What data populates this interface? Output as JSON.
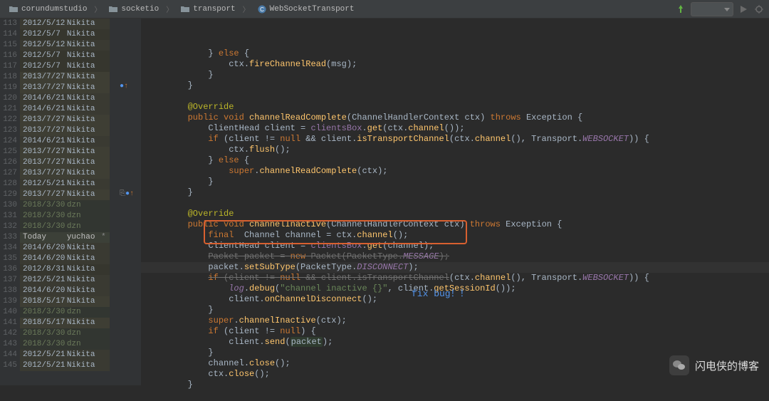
{
  "breadcrumbs": [
    {
      "icon": "folder",
      "label": "corundumstudio"
    },
    {
      "icon": "folder",
      "label": "socketio"
    },
    {
      "icon": "folder",
      "label": "transport"
    },
    {
      "icon": "class",
      "label": "WebSocketTransport"
    }
  ],
  "annotations": [
    {
      "line": 113,
      "date": "2012/5/12",
      "author": "Nikita",
      "cls": "bg-a"
    },
    {
      "line": 114,
      "date": "2012/5/7",
      "author": "Nikita",
      "cls": "bg-b"
    },
    {
      "line": 115,
      "date": "2012/5/12",
      "author": "Nikita",
      "cls": "bg-a"
    },
    {
      "line": 116,
      "date": "2012/5/7",
      "author": "Nikita",
      "cls": "bg-b"
    },
    {
      "line": 117,
      "date": "2012/5/7",
      "author": "Nikita",
      "cls": "bg-b"
    },
    {
      "line": 118,
      "date": "2013/7/27",
      "author": "Nikita",
      "cls": "bg-c"
    },
    {
      "line": 119,
      "date": "2013/7/27",
      "author": "Nikita",
      "cls": "bg-c",
      "marker": "o↑"
    },
    {
      "line": 120,
      "date": "2014/6/21",
      "author": "Nikita",
      "cls": "bg-a"
    },
    {
      "line": 121,
      "date": "2014/6/21",
      "author": "Nikita",
      "cls": "bg-a"
    },
    {
      "line": 122,
      "date": "2013/7/27",
      "author": "Nikita",
      "cls": "bg-c"
    },
    {
      "line": 123,
      "date": "2013/7/27",
      "author": "Nikita",
      "cls": "bg-c"
    },
    {
      "line": 124,
      "date": "2014/6/21",
      "author": "Nikita",
      "cls": "bg-a"
    },
    {
      "line": 125,
      "date": "2013/7/27",
      "author": "Nikita",
      "cls": "bg-c"
    },
    {
      "line": 126,
      "date": "2013/7/27",
      "author": "Nikita",
      "cls": "bg-c"
    },
    {
      "line": 127,
      "date": "2013/7/27",
      "author": "Nikita",
      "cls": "bg-c"
    },
    {
      "line": 128,
      "date": "2012/5/21",
      "author": "Nikita",
      "cls": "bg-a"
    },
    {
      "line": 129,
      "date": "2013/7/27",
      "author": "Nikita",
      "cls": "bg-c",
      "marker": "⎘o↑"
    },
    {
      "line": 130,
      "date": "2018/3/30",
      "author": "dzn",
      "cls": "bg-d ann-dzn"
    },
    {
      "line": 131,
      "date": "2018/3/30",
      "author": "dzn",
      "cls": "bg-d ann-dzn"
    },
    {
      "line": 132,
      "date": "2018/3/30",
      "author": "dzn",
      "cls": "bg-d ann-dzn"
    },
    {
      "line": 133,
      "date": "Today",
      "author": "yuchao",
      "cls": "bg-e ann-today",
      "star": "*"
    },
    {
      "line": 134,
      "date": "2014/6/20",
      "author": "Nikita",
      "cls": "bg-a"
    },
    {
      "line": 135,
      "date": "2014/6/20",
      "author": "Nikita",
      "cls": "bg-a"
    },
    {
      "line": 136,
      "date": "2012/8/31",
      "author": "Nikita",
      "cls": "bg-b"
    },
    {
      "line": 137,
      "date": "2012/5/21",
      "author": "Nikita",
      "cls": "bg-a"
    },
    {
      "line": 138,
      "date": "2014/6/20",
      "author": "Nikita",
      "cls": "bg-a"
    },
    {
      "line": 139,
      "date": "2018/5/17",
      "author": "Nikita",
      "cls": "bg-c"
    },
    {
      "line": 140,
      "date": "2018/3/30",
      "author": "dzn",
      "cls": "bg-d ann-dzn"
    },
    {
      "line": 141,
      "date": "2018/5/17",
      "author": "Nikita",
      "cls": "bg-c"
    },
    {
      "line": 142,
      "date": "2018/3/30",
      "author": "dzn",
      "cls": "bg-d ann-dzn"
    },
    {
      "line": 143,
      "date": "2018/3/30",
      "author": "dzn",
      "cls": "bg-d ann-dzn"
    },
    {
      "line": 144,
      "date": "2012/5/21",
      "author": "Nikita",
      "cls": "bg-a"
    },
    {
      "line": 145,
      "date": "2012/5/21",
      "author": "Nikita",
      "cls": "bg-a"
    }
  ],
  "code_tokens": {
    "override": "@Override",
    "public": "public",
    "void": "void",
    "final": "final",
    "throws": "throws",
    "if": "if",
    "else": "else",
    "new": "new",
    "null": "null",
    "super": "super",
    "channelReadComplete": "channelReadComplete",
    "channelInactive": "channelInactive",
    "ChannelHandlerContext": "ChannelHandlerContext",
    "Exception": "Exception",
    "ClientHead": "ClientHead",
    "Channel": "Channel",
    "Transport": "Transport",
    "Packet": "Packet",
    "PacketType": "PacketType",
    "clientsBox": "clientsBox",
    "client": "client",
    "ctx": "ctx",
    "msg": "msg",
    "channel": "channel",
    "packet": "packet",
    "log": "log",
    "fireChannelRead": "fireChannelRead",
    "isTransportChannel": "isTransportChannel",
    "flush": "flush",
    "get": "get",
    "setSubType": "setSubType",
    "debug": "debug",
    "getSessionId": "getSessionId",
    "onChannelDisconnect": "onChannelDisconnect",
    "send": "send",
    "close": "close",
    "WEBSOCKET": "WEBSOCKET",
    "MESSAGE": "MESSAGE",
    "DISCONNECT": "DISCONNECT",
    "str_channel_inactive": "\"channel inactive {}\""
  },
  "fix_bug_label": "fix bug！！",
  "watermark": "闪电侠的博客"
}
